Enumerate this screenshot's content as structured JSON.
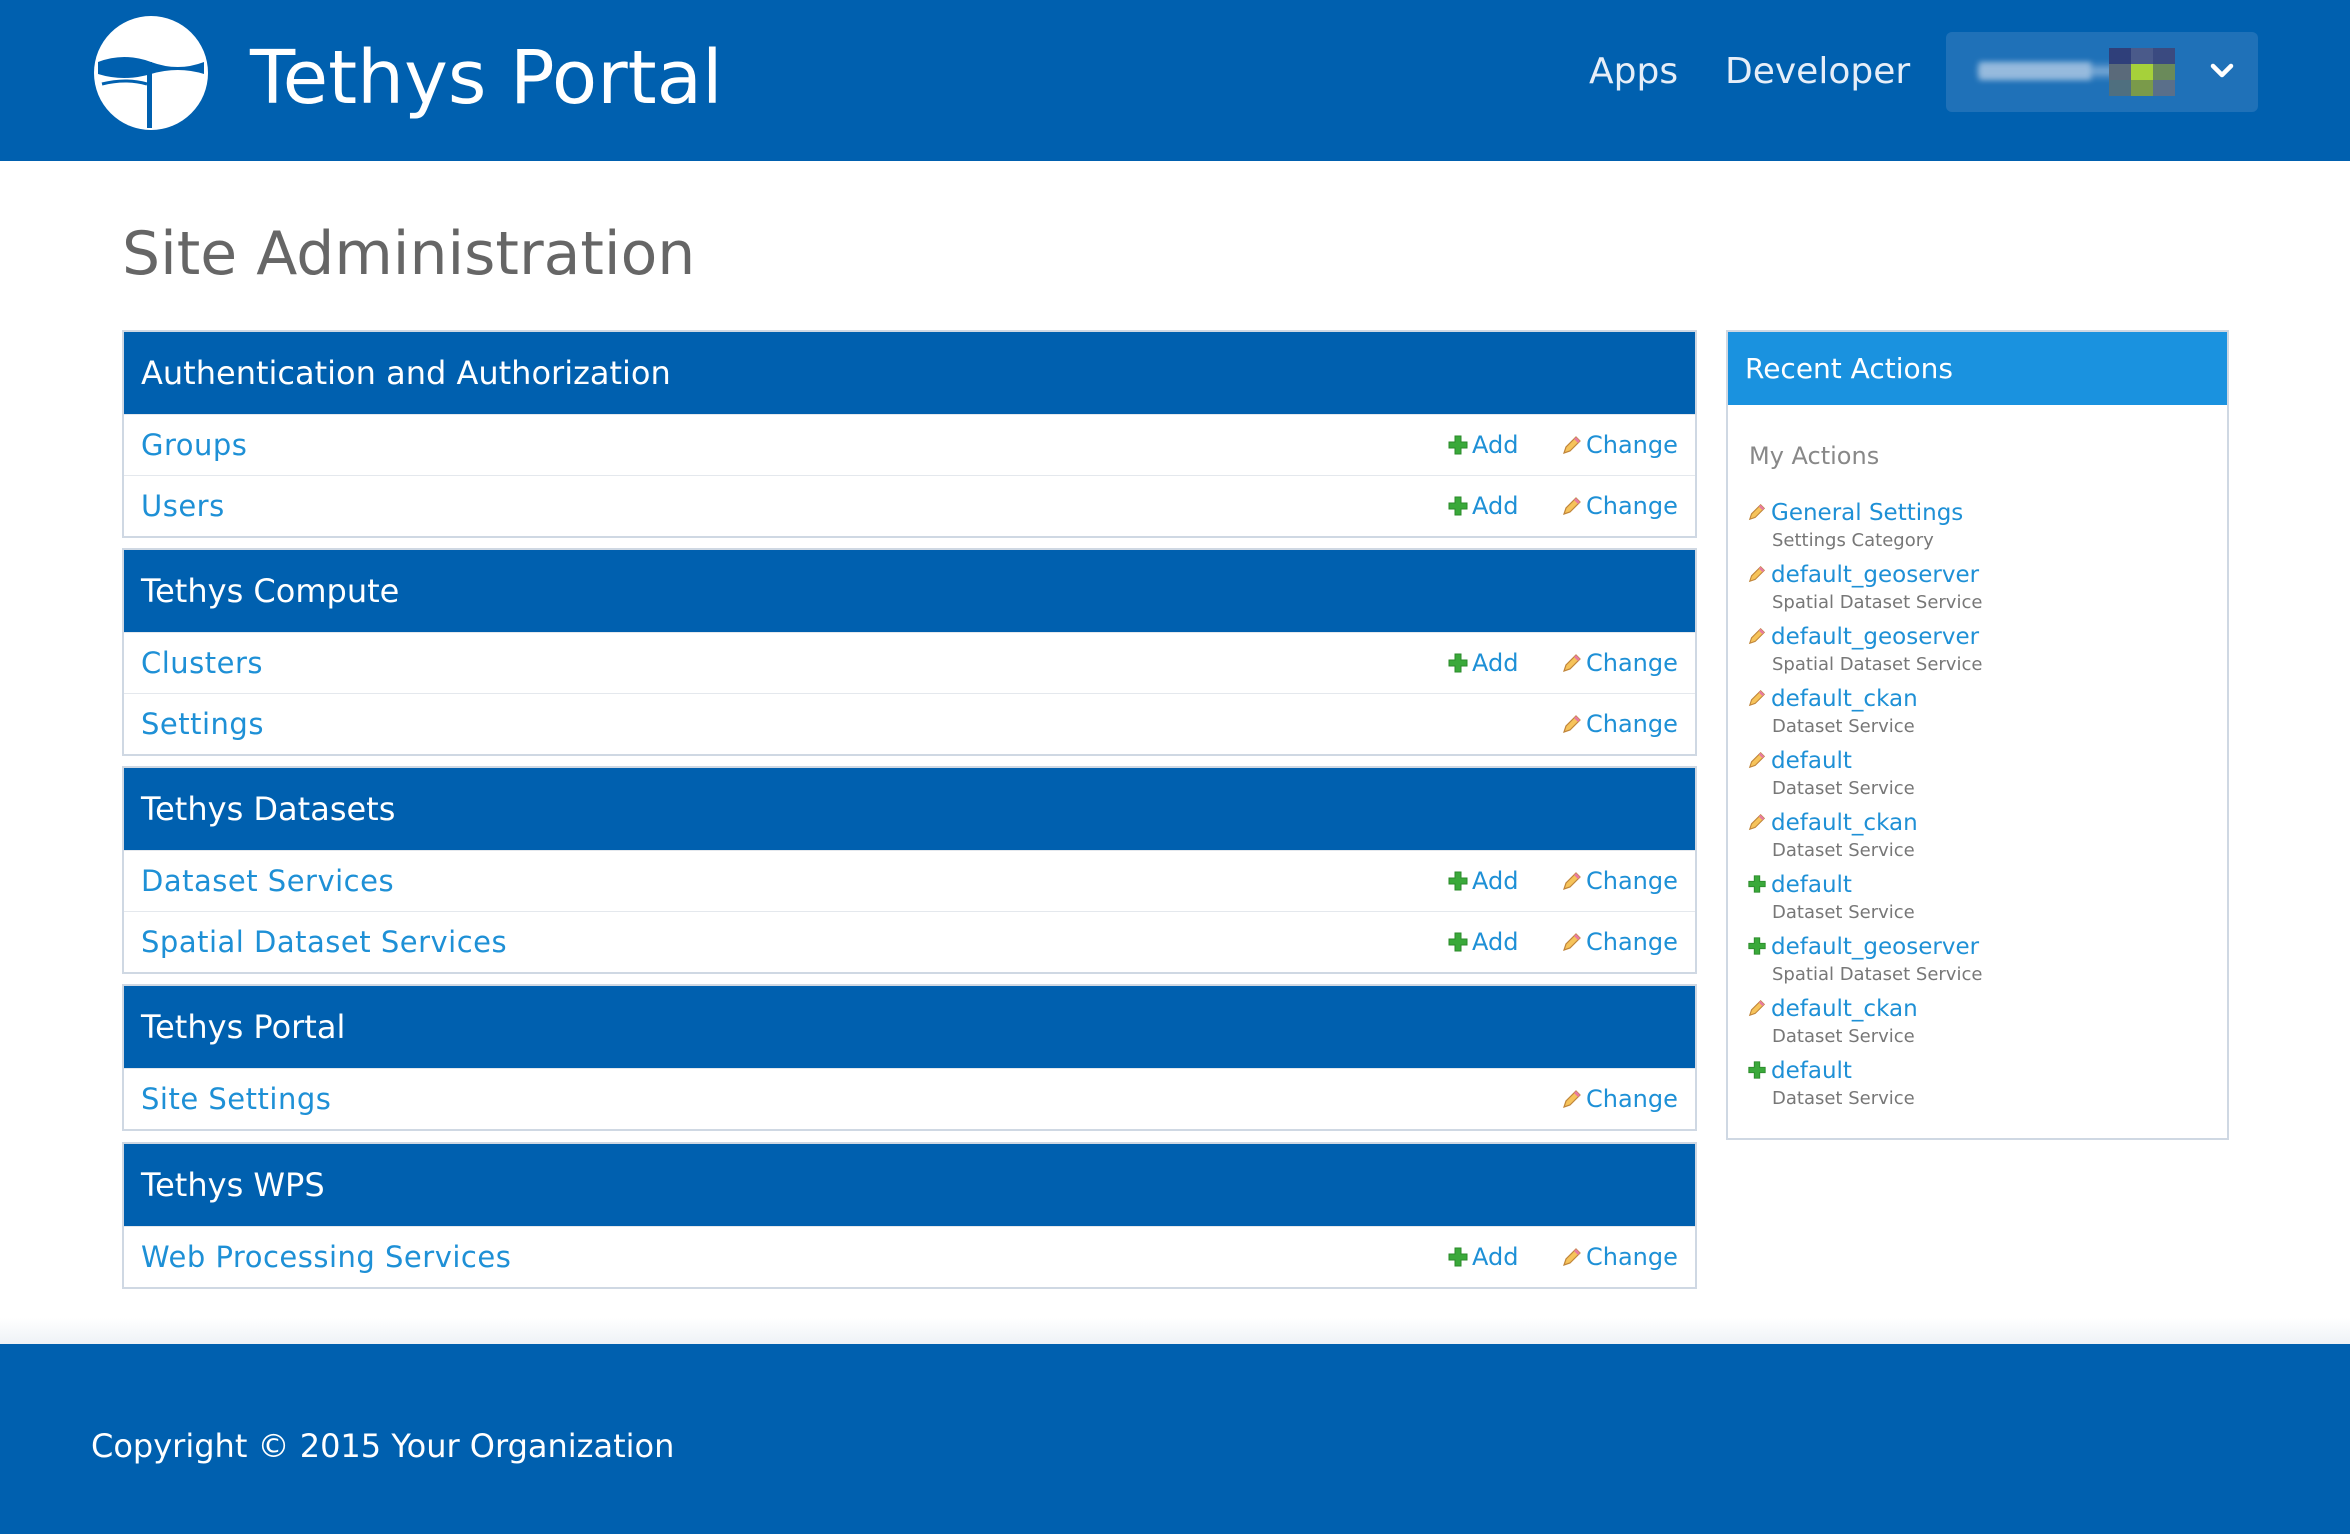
{
  "header": {
    "brand": "Tethys Portal",
    "nav": [
      {
        "label": "Apps"
      },
      {
        "label": "Developer"
      }
    ]
  },
  "page": {
    "title": "Site Administration"
  },
  "modules": [
    {
      "title": "Authentication and Authorization",
      "rows": [
        {
          "label": "Groups",
          "add": "Add",
          "change": "Change"
        },
        {
          "label": "Users",
          "add": "Add",
          "change": "Change"
        }
      ]
    },
    {
      "title": "Tethys Compute",
      "rows": [
        {
          "label": "Clusters",
          "add": "Add",
          "change": "Change"
        },
        {
          "label": "Settings",
          "change": "Change"
        }
      ]
    },
    {
      "title": "Tethys Datasets",
      "rows": [
        {
          "label": "Dataset Services",
          "add": "Add",
          "change": "Change"
        },
        {
          "label": "Spatial Dataset Services",
          "add": "Add",
          "change": "Change"
        }
      ]
    },
    {
      "title": "Tethys Portal",
      "rows": [
        {
          "label": "Site Settings",
          "change": "Change"
        }
      ]
    },
    {
      "title": "Tethys WPS",
      "rows": [
        {
          "label": "Web Processing Services",
          "add": "Add",
          "change": "Change"
        }
      ]
    }
  ],
  "recent_actions": {
    "title": "Recent Actions",
    "subtitle": "My Actions",
    "items": [
      {
        "icon": "pencil-icon",
        "name": "General Settings",
        "type": "Settings Category"
      },
      {
        "icon": "pencil-icon",
        "name": "default_geoserver",
        "type": "Spatial Dataset Service"
      },
      {
        "icon": "pencil-icon",
        "name": "default_geoserver",
        "type": "Spatial Dataset Service"
      },
      {
        "icon": "pencil-icon",
        "name": "default_ckan",
        "type": "Dataset Service"
      },
      {
        "icon": "pencil-icon",
        "name": "default",
        "type": "Dataset Service"
      },
      {
        "icon": "pencil-icon",
        "name": "default_ckan",
        "type": "Dataset Service"
      },
      {
        "icon": "plus-icon",
        "name": "default",
        "type": "Dataset Service"
      },
      {
        "icon": "plus-icon",
        "name": "default_geoserver",
        "type": "Spatial Dataset Service"
      },
      {
        "icon": "pencil-icon",
        "name": "default_ckan",
        "type": "Dataset Service"
      },
      {
        "icon": "plus-icon",
        "name": "default",
        "type": "Dataset Service"
      }
    ]
  },
  "footer": {
    "copyright": "Copyright © 2015 Your Organization"
  },
  "colors": {
    "primary": "#0060af",
    "link": "#1e90d6",
    "recent_header": "#1a92df",
    "add_green": "#3aa93a"
  }
}
